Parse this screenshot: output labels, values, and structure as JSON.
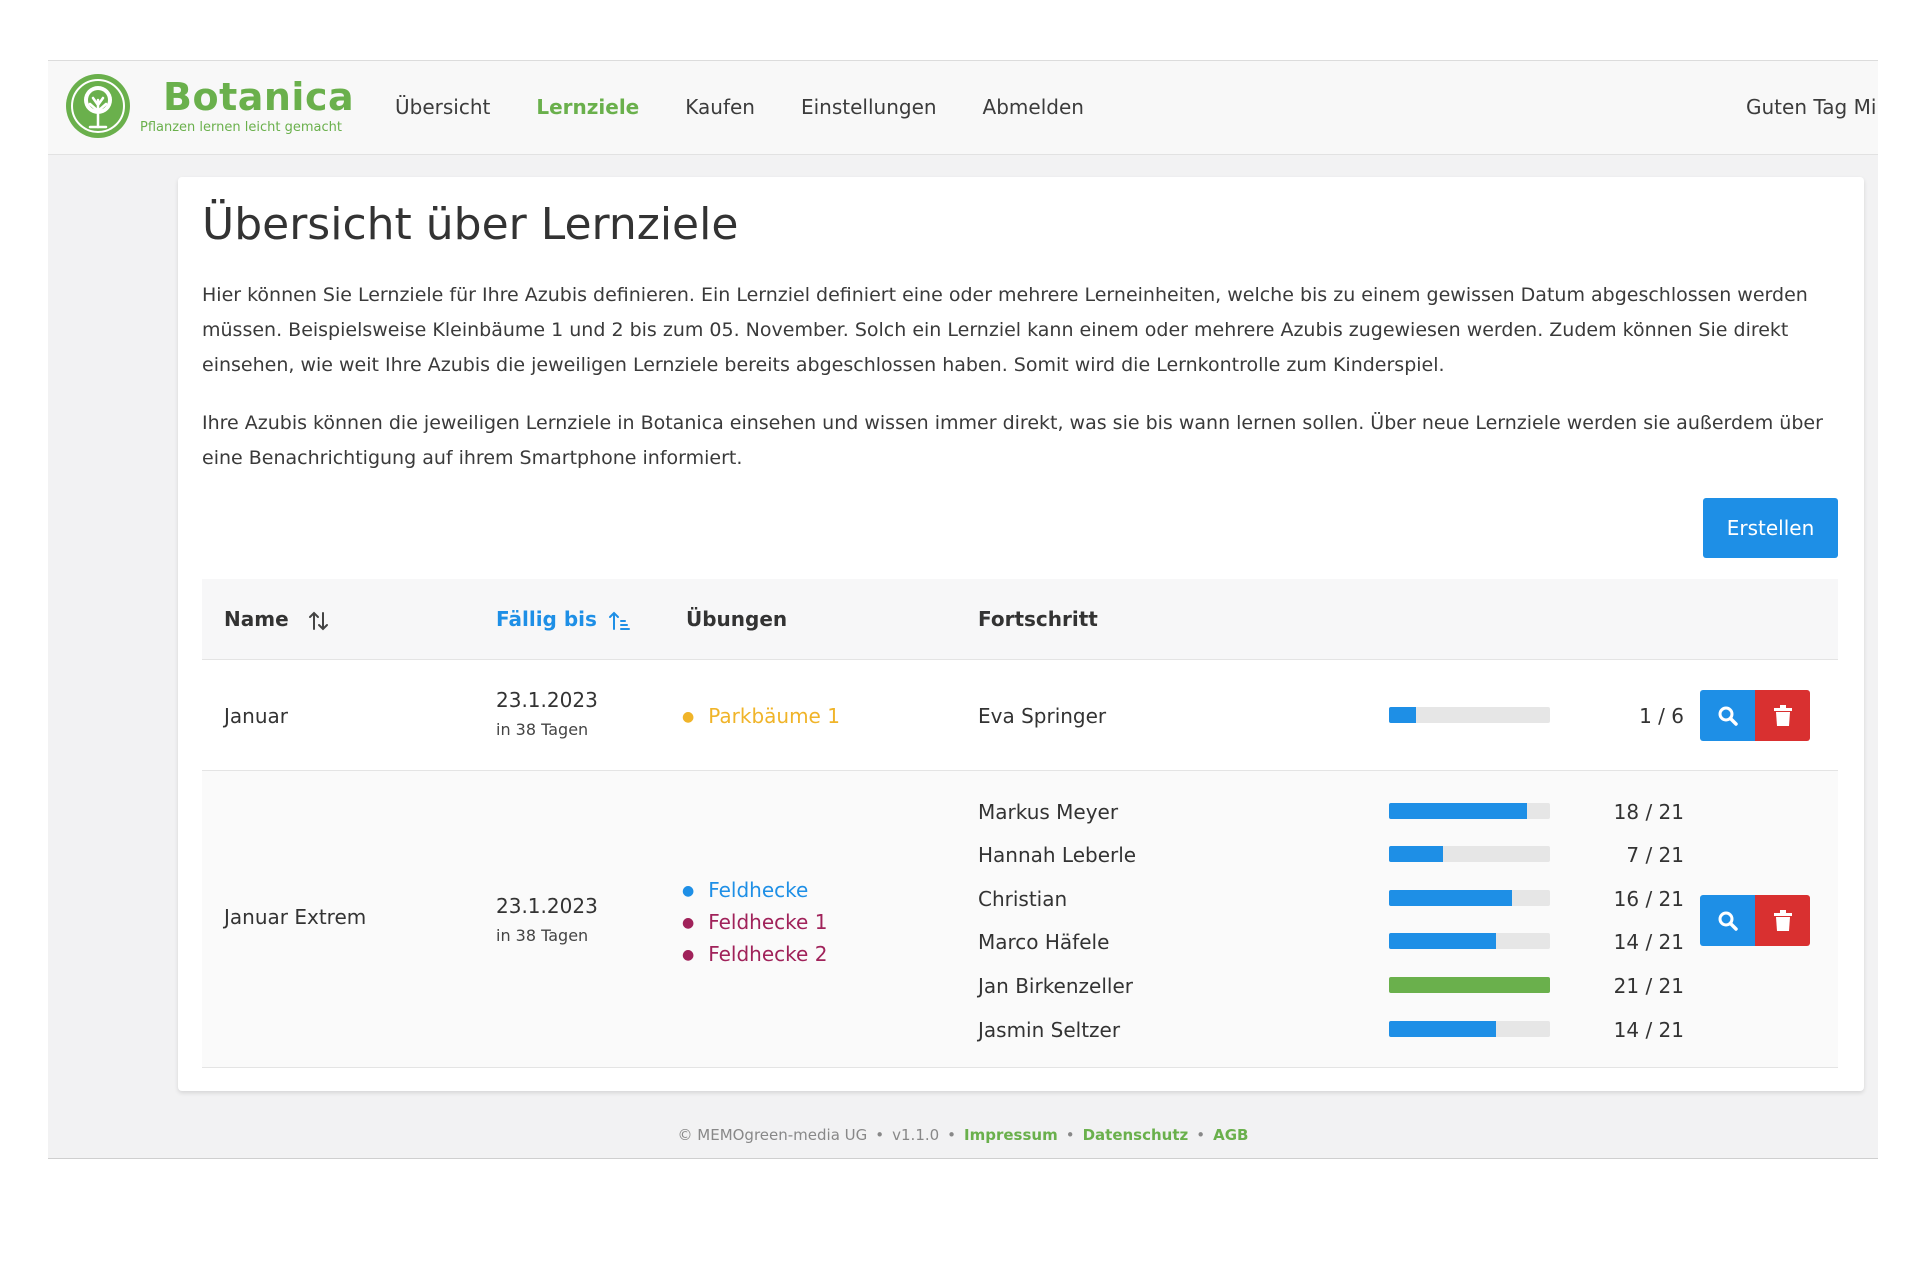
{
  "header": {
    "brand_name": "Botanica",
    "brand_tagline": "Pflanzen lernen leicht gemacht",
    "nav": [
      {
        "label": "Übersicht",
        "active": false
      },
      {
        "label": "Lernziele",
        "active": true
      },
      {
        "label": "Kaufen",
        "active": false
      },
      {
        "label": "Einstellungen",
        "active": false
      },
      {
        "label": "Abmelden",
        "active": false
      }
    ],
    "greeting": "Guten Tag Mi"
  },
  "main": {
    "title": "Übersicht über Lernziele",
    "paragraphs": [
      "Hier können Sie Lernziele für Ihre Azubis definieren. Ein Lernziel definiert eine oder mehrere Lerneinheiten, welche bis zu einem gewissen Datum abgeschlossen werden müssen. Beispielsweise Kleinbäume 1 und 2 bis zum 05. November. Solch ein Lernziel kann einem oder mehrere Azubis zugewiesen werden. Zudem können Sie direkt einsehen, wie weit Ihre Azubis die jeweiligen Lernziele bereits abgeschlossen haben. Somit wird die Lernkontrolle zum Kinderspiel.",
      "Ihre Azubis können die jeweiligen Lernziele in Botanica einsehen und wissen immer direkt, was sie bis wann lernen sollen. Über neue Lernziele werden sie außerdem über eine Benachrichtigung auf ihrem Smartphone informiert."
    ],
    "create_button": "Erstellen"
  },
  "table": {
    "columns": {
      "name": "Name",
      "due": "Fällig bis",
      "exercises": "Übungen",
      "progress": "Fortschritt"
    },
    "rows": [
      {
        "name": "Januar",
        "due_date": "23.1.2023",
        "due_relative": "in 38 Tagen",
        "exercises": [
          {
            "label": "Parkbäume 1",
            "color": "#f0b429"
          }
        ],
        "progress": [
          {
            "name": "Eva Springer",
            "done": 1,
            "total": 6,
            "count": "1 / 6"
          }
        ]
      },
      {
        "name": "Januar Extrem",
        "due_date": "23.1.2023",
        "due_relative": "in 38 Tagen",
        "exercises": [
          {
            "label": "Feldhecke",
            "color": "#1e8fe6"
          },
          {
            "label": "Feldhecke 1",
            "color": "#a0225a"
          },
          {
            "label": "Feldhecke 2",
            "color": "#a0225a"
          }
        ],
        "progress": [
          {
            "name": "Markus Meyer",
            "done": 18,
            "total": 21,
            "count": "18 / 21"
          },
          {
            "name": "Hannah Leberle",
            "done": 7,
            "total": 21,
            "count": "7 / 21"
          },
          {
            "name": "Christian",
            "done": 16,
            "total": 21,
            "count": "16 / 21"
          },
          {
            "name": "Marco Häfele",
            "done": 14,
            "total": 21,
            "count": "14 / 21"
          },
          {
            "name": "Jan Birkenzeller",
            "done": 21,
            "total": 21,
            "count": "21 / 21"
          },
          {
            "name": "Jasmin Seltzer",
            "done": 14,
            "total": 21,
            "count": "14 / 21"
          }
        ]
      }
    ]
  },
  "footer": {
    "copyright": "© MEMOgreen-media UG",
    "version": "v1.1.0",
    "links": [
      "Impressum",
      "Datenschutz",
      "AGB"
    ]
  },
  "icons": {
    "logo": "tree-logo-icon",
    "sort_name": "sort-arrows-icon",
    "sort_due": "sort-ascending-icon",
    "view": "magnifier-icon",
    "delete": "trash-icon"
  },
  "colors": {
    "brand_green": "#6ab04c",
    "primary_blue": "#1e8fe6",
    "danger_red": "#d93030",
    "exercise_yellow": "#f0b429",
    "exercise_purple": "#a0225a"
  }
}
